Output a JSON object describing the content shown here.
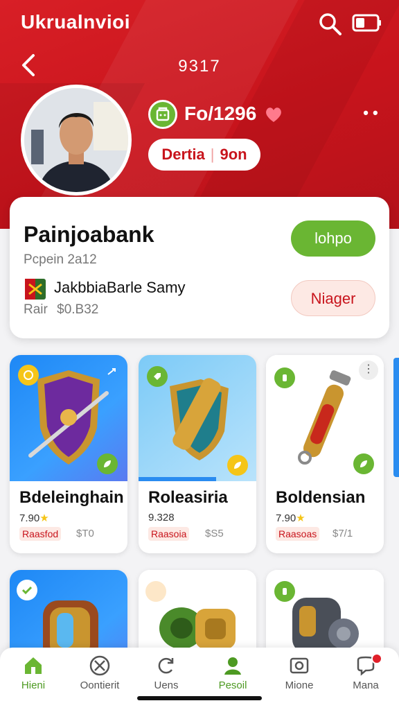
{
  "header": {
    "app_title": "Ukrualnvioi",
    "code": "9317",
    "stat_value": "Fo/1296",
    "status_pill": {
      "left": "Dertia",
      "right": "9on"
    }
  },
  "profile": {
    "name": "Painjoabank",
    "subtitle": "Pcpein 2a12",
    "org": "JakbbiaBarle Samy",
    "price_label": "Rair",
    "price_value": "$0.B32",
    "primary_button": "lohpo",
    "secondary_button": "Niager"
  },
  "items": [
    {
      "name": "Bdeleinghain",
      "rating": "7.90",
      "tag": "Raasfod",
      "price": "$T0"
    },
    {
      "name": "Roleasiria",
      "rating": "9.328",
      "tag": "Raasoia",
      "price": "$S5"
    },
    {
      "name": "Boldensian",
      "rating": "7.90",
      "tag": "Raasoas",
      "price": "$7/1"
    }
  ],
  "nav": [
    {
      "label": "Hieni",
      "icon": "home-icon"
    },
    {
      "label": "Oontierit",
      "icon": "tools-icon"
    },
    {
      "label": "Uens",
      "icon": "refresh-icon"
    },
    {
      "label": "Pesoil",
      "icon": "person-icon"
    },
    {
      "label": "Mione",
      "icon": "camera-icon"
    },
    {
      "label": "Mana",
      "icon": "chat-icon"
    }
  ],
  "colors": {
    "brand_red": "#c8141c",
    "accent_green": "#6ab633"
  }
}
